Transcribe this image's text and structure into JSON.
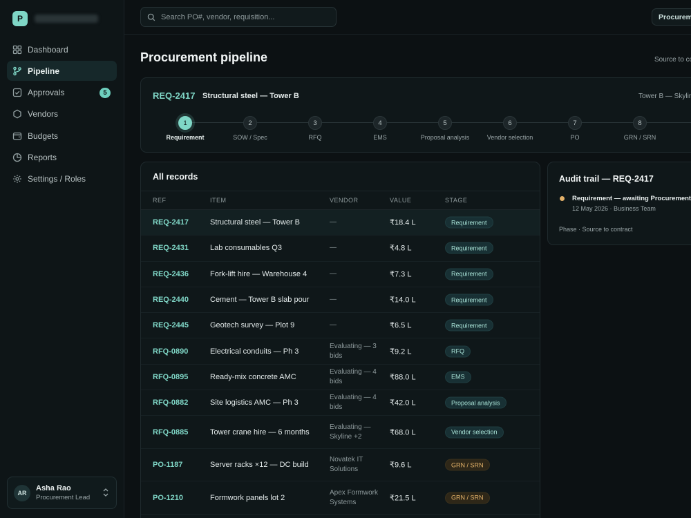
{
  "sidebar": {
    "brand_initial": "P",
    "items": [
      {
        "label": "Dashboard",
        "icon": "grid-icon"
      },
      {
        "label": "Pipeline",
        "icon": "branch-icon",
        "active": true
      },
      {
        "label": "Approvals",
        "icon": "check-square-icon",
        "badge": "5"
      },
      {
        "label": "Vendors",
        "icon": "hexagon-icon"
      },
      {
        "label": "Budgets",
        "icon": "wallet-icon"
      },
      {
        "label": "Reports",
        "icon": "pie-chart-icon"
      },
      {
        "label": "Settings / Roles",
        "icon": "gear-icon"
      }
    ],
    "user": {
      "initials": "AR",
      "name": "Asha Rao",
      "role": "Procurement Lead"
    }
  },
  "topbar": {
    "search_placeholder": "Search PO#, vendor, requisition...",
    "chip_label": "Procurement"
  },
  "page": {
    "title": "Procurement pipeline",
    "subtitle": "Source to contract"
  },
  "pipeline": {
    "req_id": "REQ-2417",
    "req_title": "Structural steel — Tower B",
    "req_location": "Tower B — Skyline",
    "steps": [
      {
        "num": "1",
        "label": "Requirement"
      },
      {
        "num": "2",
        "label": "SOW / Spec"
      },
      {
        "num": "3",
        "label": "RFQ"
      },
      {
        "num": "4",
        "label": "EMS"
      },
      {
        "num": "5",
        "label": "Proposal analysis"
      },
      {
        "num": "6",
        "label": "Vendor selection"
      },
      {
        "num": "7",
        "label": "PO"
      },
      {
        "num": "8",
        "label": "GRN / SRN"
      }
    ]
  },
  "records": {
    "title": "All records",
    "columns": {
      "ref": "REF",
      "item": "ITEM",
      "vendor": "VENDOR",
      "value": "VALUE",
      "stage": "STAGE"
    },
    "rows": [
      {
        "ref": "REQ-2417",
        "item": "Structural steel — Tower B",
        "vendor": "—",
        "value": "₹18.4 L",
        "stage": "Requirement",
        "tone": "teal"
      },
      {
        "ref": "REQ-2431",
        "item": "Lab consumables Q3",
        "vendor": "—",
        "value": "₹4.8 L",
        "stage": "Requirement",
        "tone": "teal"
      },
      {
        "ref": "REQ-2436",
        "item": "Fork-lift hire — Warehouse 4",
        "vendor": "—",
        "value": "₹7.3 L",
        "stage": "Requirement",
        "tone": "teal"
      },
      {
        "ref": "REQ-2440",
        "item": "Cement — Tower B slab pour",
        "vendor": "—",
        "value": "₹14.0 L",
        "stage": "Requirement",
        "tone": "teal"
      },
      {
        "ref": "REQ-2445",
        "item": "Geotech survey — Plot 9",
        "vendor": "—",
        "value": "₹6.5 L",
        "stage": "Requirement",
        "tone": "teal"
      },
      {
        "ref": "RFQ-0890",
        "item": "Electrical conduits — Ph 3",
        "vendor": "Evaluating — 3 bids",
        "value": "₹9.2 L",
        "stage": "RFQ",
        "tone": "teal"
      },
      {
        "ref": "RFQ-0895",
        "item": "Ready-mix concrete AMC",
        "vendor": "Evaluating — 4 bids",
        "value": "₹88.0 L",
        "stage": "EMS",
        "tone": "teal"
      },
      {
        "ref": "RFQ-0882",
        "item": "Site logistics AMC — Ph 3",
        "vendor": "Evaluating — 4 bids",
        "value": "₹42.0 L",
        "stage": "Proposal analysis",
        "tone": "teal"
      },
      {
        "ref": "RFQ-0885",
        "item": "Tower crane hire — 6 months",
        "vendor": "Evaluating — Skyline +2",
        "value": "₹68.0 L",
        "stage": "Vendor selection",
        "tone": "teal"
      },
      {
        "ref": "PO-1187",
        "item": "Server racks ×12 — DC build",
        "vendor": "Novatek IT Solutions",
        "value": "₹9.6 L",
        "stage": "GRN / SRN",
        "tone": "amber"
      },
      {
        "ref": "PO-1210",
        "item": "Formwork panels lot 2",
        "vendor": "Apex Formwork Systems",
        "value": "₹21.5 L",
        "stage": "GRN / SRN",
        "tone": "amber"
      }
    ]
  },
  "audit": {
    "title": "Audit trail — REQ-2417",
    "event": "Requirement — awaiting Procurement",
    "meta": "12 May 2026 · Business Team",
    "phase": "Phase · Source to contract",
    "dot_color": "#e2b069"
  }
}
